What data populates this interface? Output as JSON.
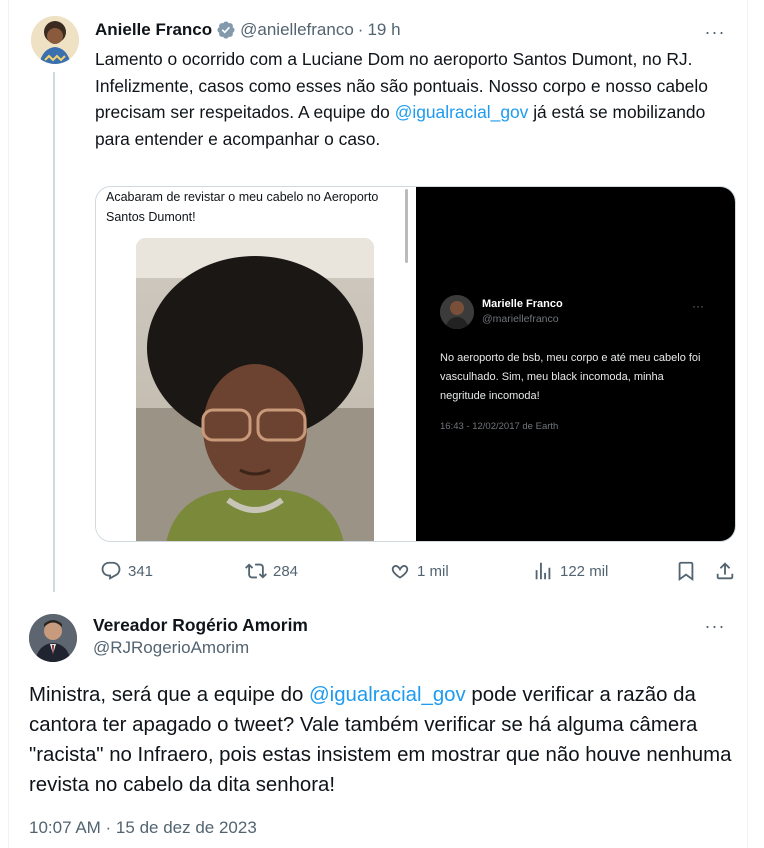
{
  "tweet": {
    "author_name": "Anielle Franco",
    "handle": "@aniellefranco",
    "separator": "·",
    "time": "19 h",
    "more": "···",
    "text_parts": [
      "Lamento o ocorrido com a Luciane Dom no aeroporto Santos Dumont, no RJ. Infelizmente, casos como esses não são pontuais. Nosso corpo e nosso cabelo precisam ser respeitados. A equipe do ",
      "@igualracial_gov",
      " já está se mobilizando para entender e acompanhar o caso."
    ],
    "media_left": {
      "caption": "Acabaram de revistar o meu cabelo no Aeroporto Santos Dumont!"
    },
    "media_right": {
      "name": "Marielle Franco",
      "handle": "@mariellefranco",
      "more": "···",
      "text": "No aeroporto de bsb, meu corpo e até meu cabelo foi vasculhado. Sim, meu black incomoda, minha negritude incomoda!",
      "meta": "16:43 - 12/02/2017 de Earth"
    },
    "stats": {
      "replies": "341",
      "retweets": "284",
      "likes": "1 mil",
      "views": "122 mil"
    },
    "icons": [
      "reply-icon",
      "retweet-icon",
      "like-icon",
      "views-icon",
      "bookmark-icon",
      "share-icon",
      "verified-badge-icon"
    ]
  },
  "reply": {
    "author_name": "Vereador Rogério Amorim",
    "handle": "@RJRogerioAmorim",
    "more": "···",
    "text_parts": [
      "Ministra, será que a equipe do ",
      "@igualracial_gov",
      " pode verificar a razão da cantora ter apagado o tweet? Vale também verificar se há alguma câmera \"racista\" no Infraero, pois estas insistem em mostrar que não houve nenhuma revista no cabelo da dita senhora!"
    ],
    "timestamp": "10:07 AM · 15 de dez de 2023"
  },
  "colors": {
    "text": "#0f1419",
    "secondary": "#536471",
    "link": "#1d9bf0",
    "thread_line": "#cfd9de"
  }
}
